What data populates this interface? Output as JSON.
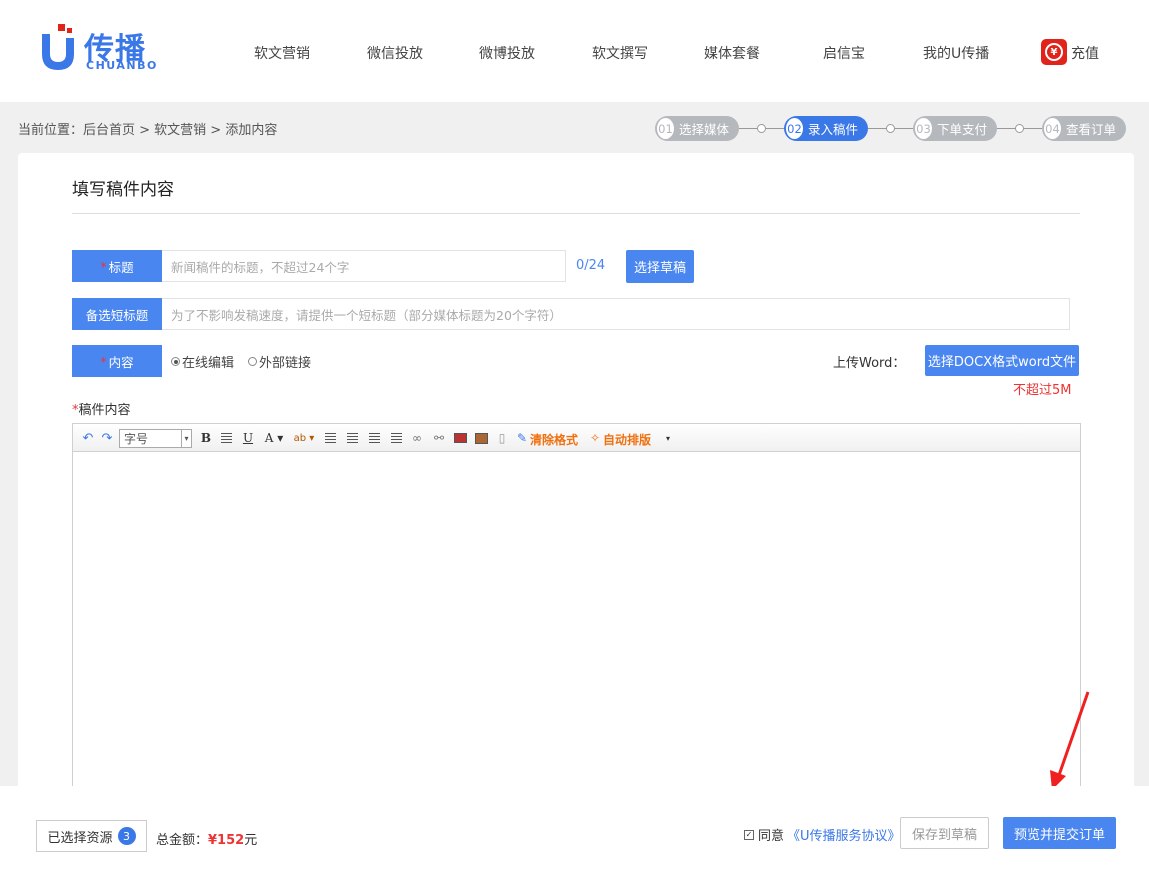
{
  "brand": {
    "name": "传播",
    "sub": "CHUANBO",
    "accent": "#3b78e7"
  },
  "nav": {
    "items": [
      "软文营销",
      "微信投放",
      "微博投放",
      "软文撰写",
      "媒体套餐",
      "启信宝",
      "我的U传播"
    ],
    "recharge": "充值"
  },
  "breadcrumb": "当前位置：后台首页 > 软文营销 > 添加内容",
  "steps": [
    {
      "num": "01",
      "label": "选择媒体"
    },
    {
      "num": "02",
      "label": "录入稿件"
    },
    {
      "num": "03",
      "label": "下单支付"
    },
    {
      "num": "04",
      "label": "查看订单"
    }
  ],
  "form": {
    "section_title": "填写稿件内容",
    "required_mark": "*",
    "title_label": "标题",
    "title_placeholder": "新闻稿件的标题，不超过24个字",
    "title_counter": "0/24",
    "choose_draft": "选择草稿",
    "alt_title_label": "备选短标题",
    "alt_title_placeholder": "为了不影响发稿速度，请提供一个短标题（部分媒体标题为20个字符）",
    "content_label": "内容",
    "radio_online": "在线编辑",
    "radio_link": "外部链接",
    "upload_label": "上传Word：",
    "upload_button": "选择DOCX格式word文件",
    "upload_limit": "不超过5M",
    "body_label": "稿件内容"
  },
  "editor": {
    "font_size_select": "字号",
    "clear_format": "清除格式",
    "auto_layout": "自动排版"
  },
  "footer": {
    "selected_label": "已选择资源",
    "selected_count": "3",
    "total_label": "总金额：",
    "total_amount": "¥152",
    "total_unit": "元",
    "agree_text": "同意",
    "agreement_link": "《U传播服务协议》",
    "save_draft": "保存到草稿",
    "submit": "预览并提交订单"
  }
}
